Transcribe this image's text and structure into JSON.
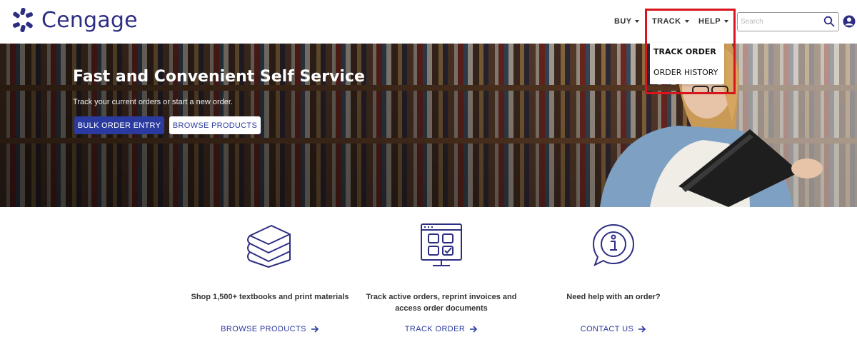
{
  "brand": {
    "name": "Cengage",
    "color": "#2d2e83"
  },
  "nav": {
    "buy": "BUY",
    "track": "TRACK",
    "help": "HELP",
    "search_placeholder": "Search"
  },
  "dropdown": {
    "items": [
      "TRACK ORDER",
      "ORDER HISTORY"
    ],
    "highlight_color": "#d8141c"
  },
  "hero": {
    "title": "Fast and Convenient Self Service",
    "subtitle": "Track your current orders or start a new order.",
    "primary_button": "BULK ORDER ENTRY",
    "secondary_button": "BROWSE PRODUCTS"
  },
  "features": [
    {
      "icon": "books-stack-icon",
      "text": "Shop 1,500+ textbooks and print materials",
      "link": "BROWSE PRODUCTS"
    },
    {
      "icon": "order-dashboard-icon",
      "text": "Track active orders, reprint invoices and access order documents",
      "link": "TRACK ORDER"
    },
    {
      "icon": "info-chat-icon",
      "text": "Need help with an order?",
      "link": "CONTACT US"
    }
  ],
  "colors": {
    "accent": "#2b3a9e",
    "icon_stroke": "#2d2e83"
  }
}
